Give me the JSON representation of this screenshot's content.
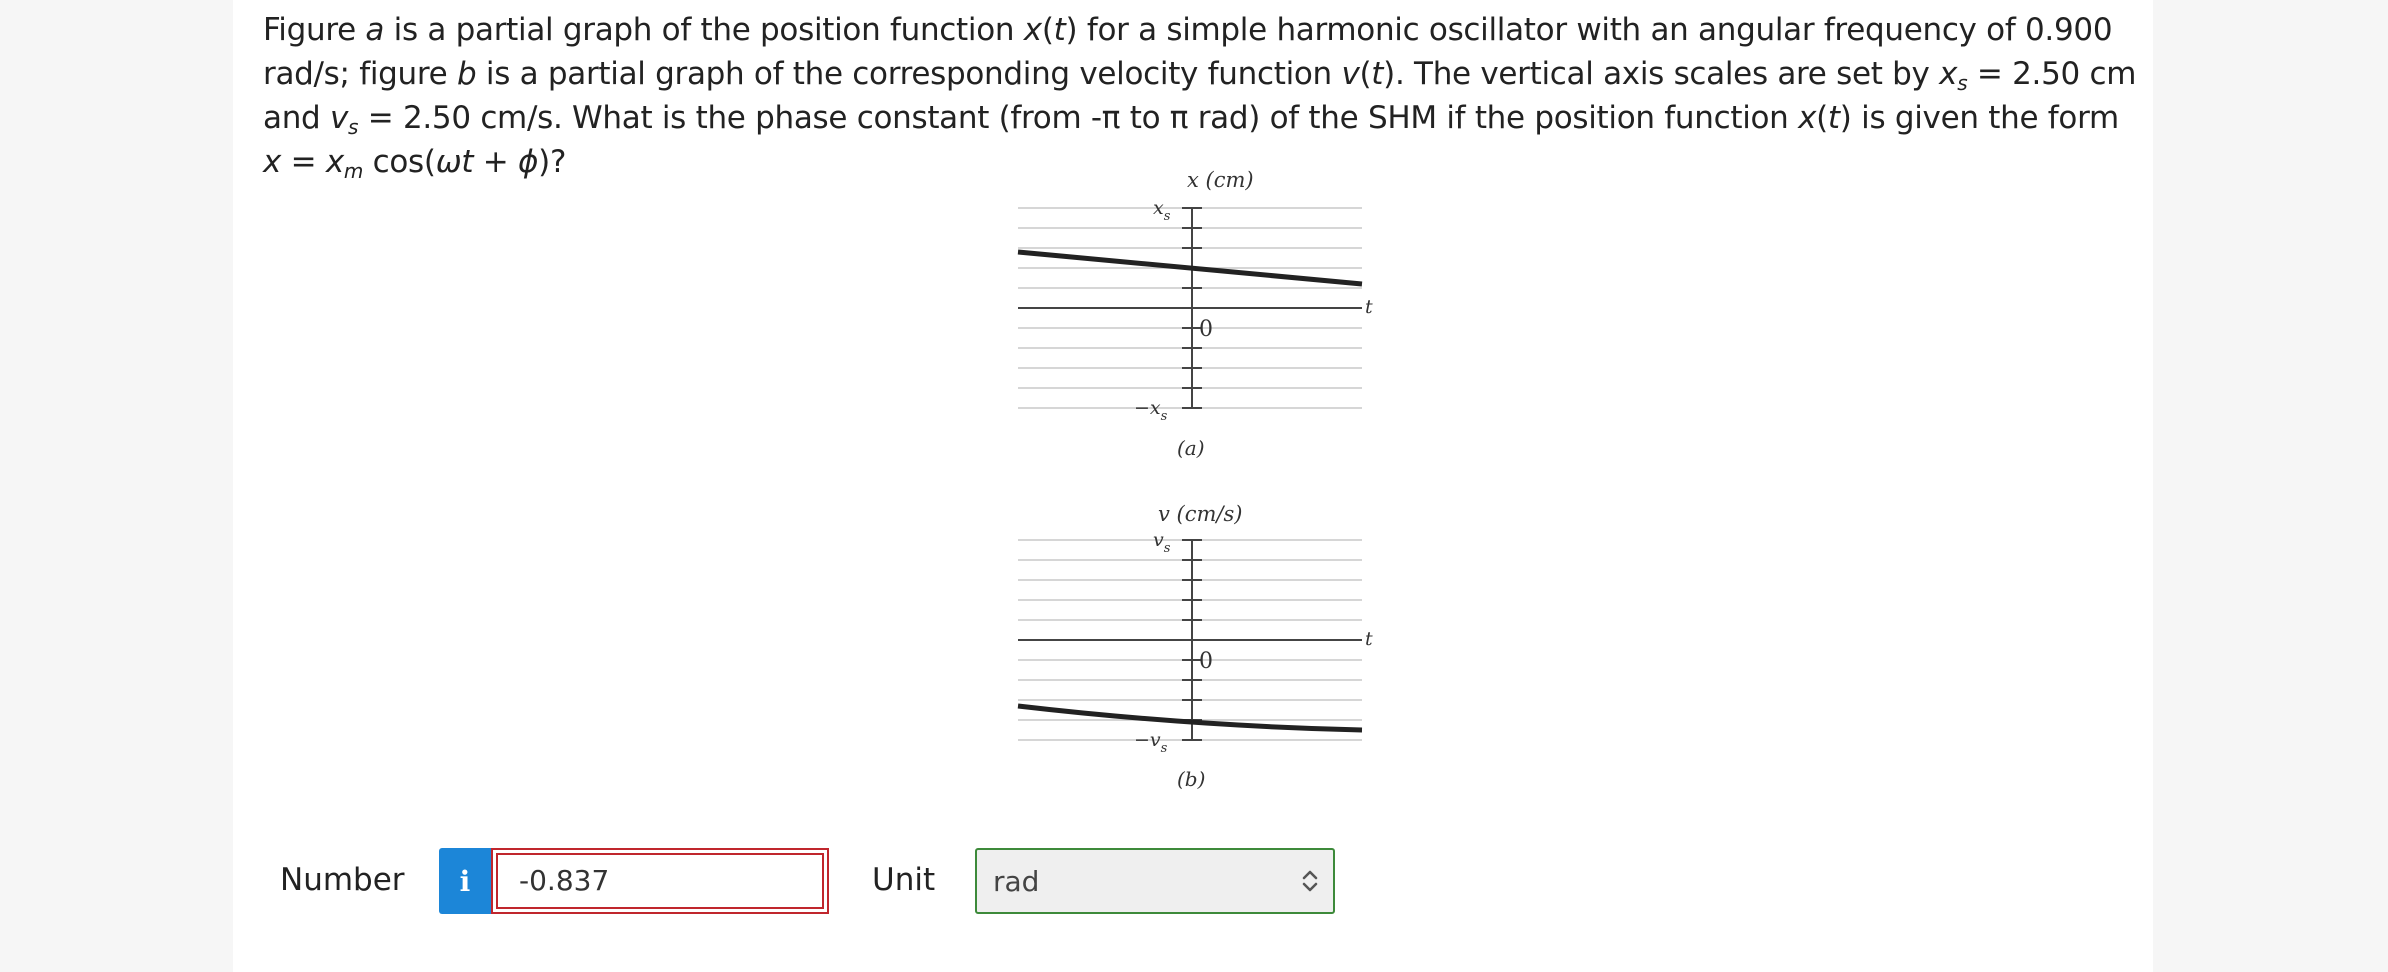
{
  "question": {
    "p1": "Figure ",
    "a": "a",
    "p2": " is a partial graph of the position function ",
    "xt": "x",
    "p3": "(",
    "t1": "t",
    "p4": ") for a simple harmonic oscillator with an angular frequency of 0.900 rad/s; figure ",
    "b": "b",
    "p5": " is a partial graph of the corresponding velocity function ",
    "vt": "v",
    "p6": "(",
    "t2": "t",
    "p7": "). The vertical axis scales are set by ",
    "xs_x": "x",
    "xs_s": "s",
    "p8": " = 2.50 cm and ",
    "vs_v": "v",
    "vs_s": "s",
    "p9": " = 2.50 cm/s. What is the phase constant (from -π to π rad) of the SHM if the position function ",
    "x2": "x",
    "p10": "(",
    "t3": "t",
    "p11": ") is given the form ",
    "x3": "x",
    "p12": " = ",
    "xm_x": "x",
    "xm_m": "m",
    "p13": " cos(",
    "wt": "ωt",
    "p14": " + ",
    "phi": "ϕ",
    "p15": ")?"
  },
  "figure_a": {
    "axis_label": "x (cm)",
    "top_tick": "x",
    "top_tick_sub": "s",
    "bottom_tick": "−x",
    "bottom_tick_sub": "s",
    "zero": "0",
    "t_label": "t",
    "caption": "(a)"
  },
  "figure_b": {
    "axis_label": "v (cm/s)",
    "top_tick": "v",
    "top_tick_sub": "s",
    "bottom_tick": "−v",
    "bottom_tick_sub": "s",
    "zero": "0",
    "t_label": "t",
    "caption": "(b)"
  },
  "answer": {
    "number_label": "Number",
    "info_icon": "i",
    "value": "-0.837",
    "unit_label": "Unit",
    "unit_value": "rad"
  },
  "colors": {
    "info_blue": "#1c86d8",
    "error_red": "#c0262d",
    "ok_green": "#3d8a3a"
  }
}
